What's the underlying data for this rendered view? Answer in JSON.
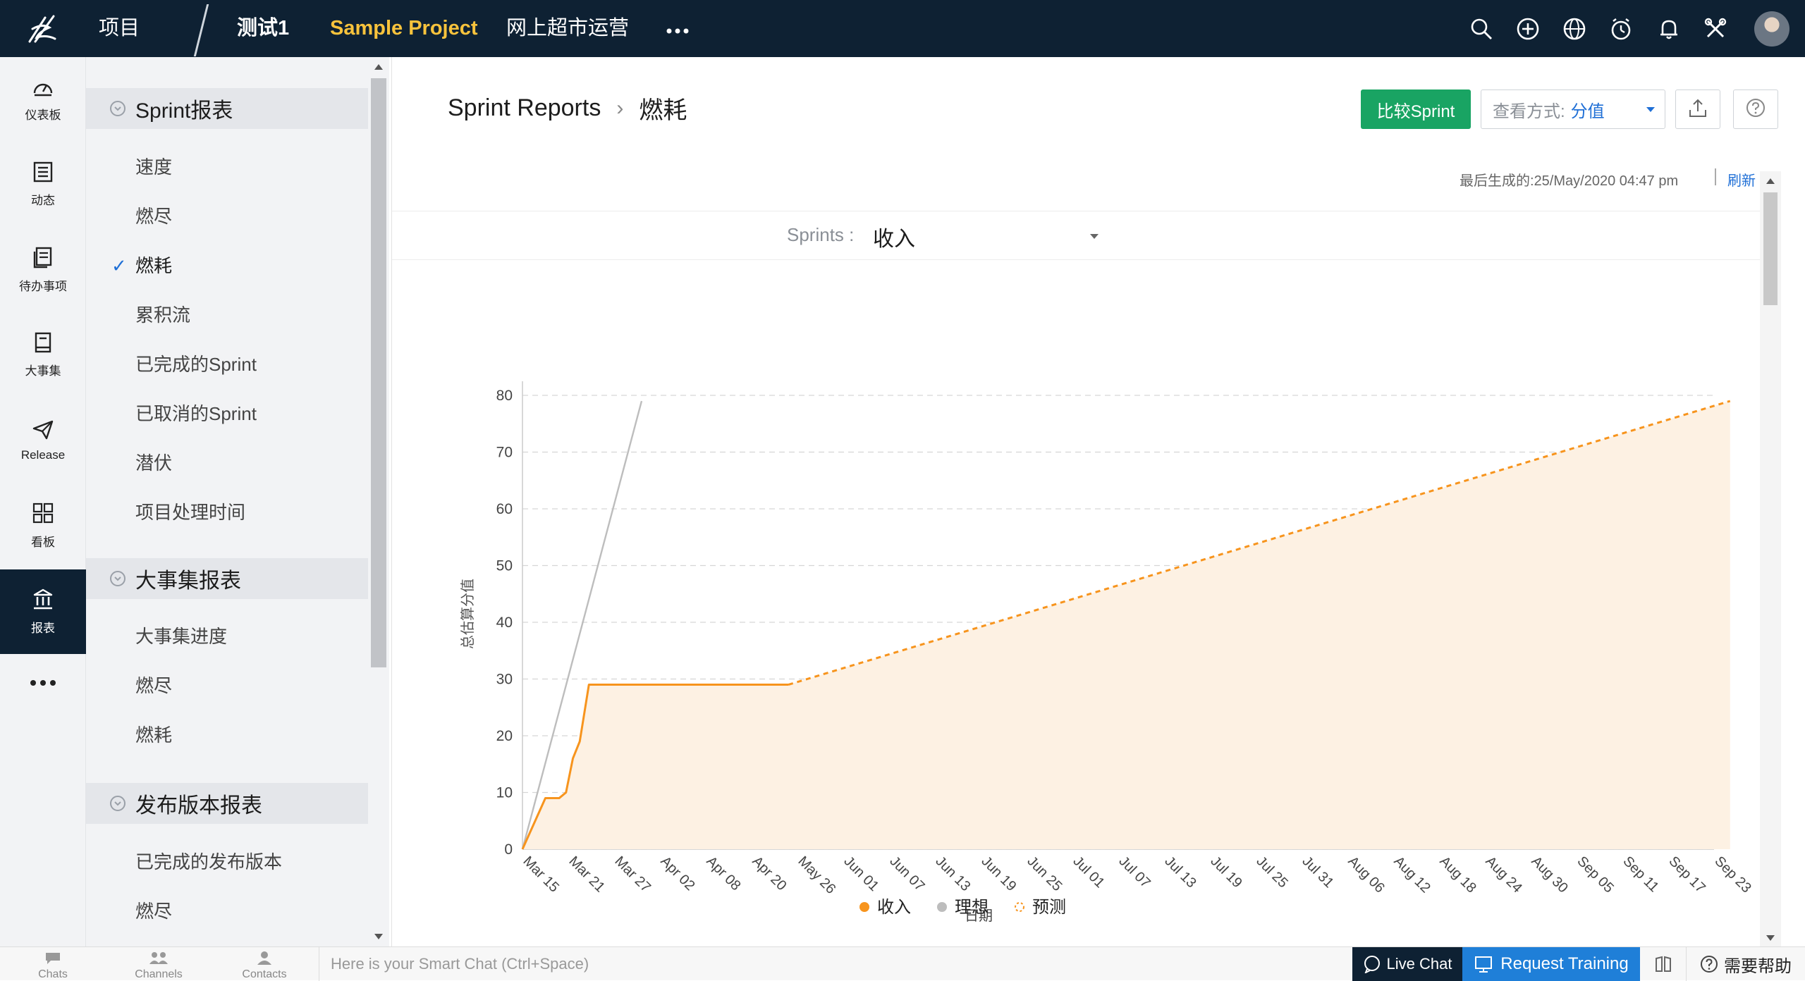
{
  "colors": {
    "topbar": "#0e2133",
    "accent": "#1f6fd6",
    "green": "#19a463",
    "orange": "#f7941d",
    "ideal": "#bdbdbd",
    "forecast_fill": "#fdf1e3"
  },
  "topbar": {
    "logo_icon": "zoho-sprints-logo-icon",
    "projects_label": "项目",
    "tabs": [
      "测试1",
      "Sample Project",
      "网上超市运营"
    ],
    "more_icon": "more-dots-icon",
    "icons": [
      "search-icon",
      "add-circle-icon",
      "globe-icon",
      "timer-icon",
      "bell-icon",
      "tools-icon"
    ]
  },
  "rail": {
    "items": [
      {
        "label": "仪表板",
        "icon": "dashboard-icon"
      },
      {
        "label": "动态",
        "icon": "feed-icon"
      },
      {
        "label": "待办事项",
        "icon": "backlog-icon"
      },
      {
        "label": "大事集",
        "icon": "epic-icon"
      },
      {
        "label": "Release",
        "icon": "release-icon"
      },
      {
        "label": "看板",
        "icon": "board-icon"
      },
      {
        "label": "报表",
        "icon": "reports-icon"
      }
    ],
    "more_icon": "more-dots-icon"
  },
  "subnav": {
    "sections": [
      {
        "title": "Sprint报表",
        "items": [
          "速度",
          "燃尽",
          "燃耗",
          "累积流",
          "已完成的Sprint",
          "已取消的Sprint",
          "潜伏",
          "项目处理时间"
        ]
      },
      {
        "title": "大事集报表",
        "items": [
          "大事集进度",
          "燃尽",
          "燃耗"
        ]
      },
      {
        "title": "发布版本报表",
        "items": [
          "已完成的发布版本",
          "燃尽"
        ]
      }
    ],
    "selected": "燃耗"
  },
  "header": {
    "breadcrumb_root": "Sprint Reports",
    "breadcrumb_current": "燃耗",
    "compare_label": "比较Sprint",
    "view_label": "查看方式:",
    "view_value": "分值",
    "export_icon": "upload-icon",
    "help_icon": "help-icon",
    "generated_label": "最后生成的:",
    "generated_time": "25/May/2020 04:47 pm",
    "refresh_label": "刷新"
  },
  "filter": {
    "label": "Sprints :",
    "value": "收入"
  },
  "chart_data": {
    "type": "line",
    "title": "",
    "xlabel": "日期",
    "ylabel": "总估算分值",
    "ylim": [
      0,
      80
    ],
    "yticks": [
      0,
      10,
      20,
      30,
      40,
      50,
      60,
      70,
      80
    ],
    "xticks": [
      "Mar 15",
      "Mar 21",
      "Mar 27",
      "Apr 02",
      "Apr 08",
      "Apr 20",
      "May 26",
      "Jun 01",
      "Jun 07",
      "Jun 13",
      "Jun 19",
      "Jun 25",
      "Jul 01",
      "Jul 07",
      "Jul 13",
      "Jul 19",
      "Jul 25",
      "Jul 31",
      "Aug 06",
      "Aug 12",
      "Aug 18",
      "Aug 24",
      "Aug 30",
      "Sep 05",
      "Sep 11",
      "Sep 17",
      "Sep 23"
    ],
    "grid": true,
    "legend_position": "bottom-center",
    "series": [
      {
        "name": "收入",
        "color": "#f7941d",
        "style": "solid",
        "points": [
          [
            0,
            0
          ],
          [
            0.5,
            9
          ],
          [
            0.8,
            9
          ],
          [
            0.95,
            10
          ],
          [
            1.1,
            16
          ],
          [
            1.25,
            19
          ],
          [
            1.45,
            29
          ],
          [
            5.8,
            29
          ]
        ]
      },
      {
        "name": "理想",
        "color": "#bdbdbd",
        "style": "solid",
        "points": [
          [
            0,
            0
          ],
          [
            2.6,
            79
          ]
        ]
      },
      {
        "name": "预测",
        "color": "#f7941d",
        "style": "dashed",
        "points": [
          [
            5.8,
            29
          ],
          [
            26.35,
            79
          ]
        ]
      }
    ]
  },
  "bottombar": {
    "chats": "Chats",
    "channels": "Channels",
    "contacts": "Contacts",
    "smartchat_placeholder": "Here is your Smart Chat (Ctrl+Space)",
    "livechat": "Live Chat",
    "request_training": "Request Training",
    "help": "需要帮助"
  }
}
